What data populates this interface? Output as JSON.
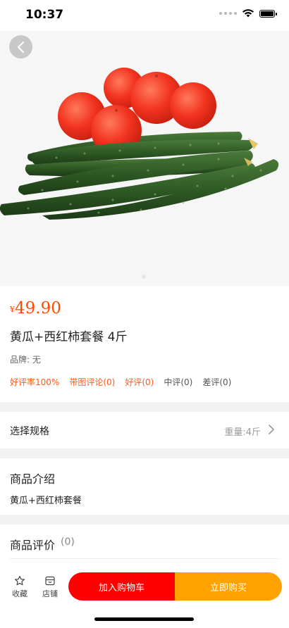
{
  "status_bar": {
    "time": "10:37"
  },
  "product": {
    "currency": "¥",
    "price": "49.90",
    "title": "黄瓜+西红柿套餐 4斤",
    "brand": "品牌: 无",
    "review_tags": [
      {
        "label": "好评率100%",
        "highlight": true
      },
      {
        "label": "带图评论(0)",
        "highlight": true
      },
      {
        "label": "好评(0)",
        "highlight": true
      },
      {
        "label": "中评(0)",
        "highlight": false
      },
      {
        "label": "差评(0)",
        "highlight": false
      }
    ]
  },
  "spec": {
    "label": "选择规格",
    "value": "重量:4斤"
  },
  "intro": {
    "title": "商品介绍",
    "text": "黄瓜+西红柿套餐"
  },
  "evaluation": {
    "title": "商品评价",
    "count": "(0)"
  },
  "bottom_bar": {
    "favorite_label": "收藏",
    "store_label": "店铺",
    "add_to_cart_label": "加入购物车",
    "buy_now_label": "立即购买"
  },
  "colors": {
    "price": "#ff4b00",
    "highlight": "#ff5a1a",
    "cart_button": "#ff0000",
    "buy_button": "#ffa200"
  },
  "icons": [
    "back-arrow-icon",
    "star-icon",
    "store-icon",
    "chevron-right-icon",
    "wifi-icon",
    "battery-icon",
    "signal-icon"
  ]
}
